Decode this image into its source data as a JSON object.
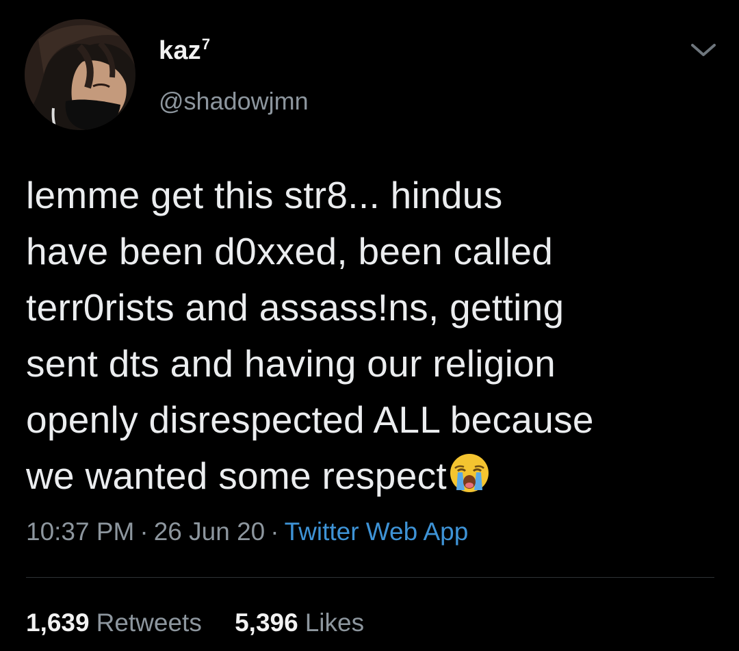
{
  "author": {
    "display_name": "kaz",
    "display_name_suffix": "7",
    "handle": "@shadowjmn"
  },
  "tweet": {
    "lines": [
      "lemme get this str8... hindus",
      "have been d0xxed, been called",
      "terr0rists and assass!ns, getting",
      "sent dts and having our religion",
      "openly disrespected ALL because",
      "we wanted some respect"
    ],
    "trailing_emoji": "loudly-crying-face-icon"
  },
  "meta": {
    "time": "10:37 PM",
    "separator": "·",
    "date": "26 Jun 20",
    "source": "Twitter Web App"
  },
  "stats": {
    "retweets_count": "1,639",
    "retweets_label": "Retweets",
    "likes_count": "5,396",
    "likes_label": "Likes"
  },
  "colors": {
    "background": "#000000",
    "text": "#ebedef",
    "secondary_text": "#8d969e",
    "link": "#3e93d6",
    "divider": "#2f3336"
  },
  "icons": {
    "menu": "chevron-down-icon",
    "avatar": "avatar"
  }
}
